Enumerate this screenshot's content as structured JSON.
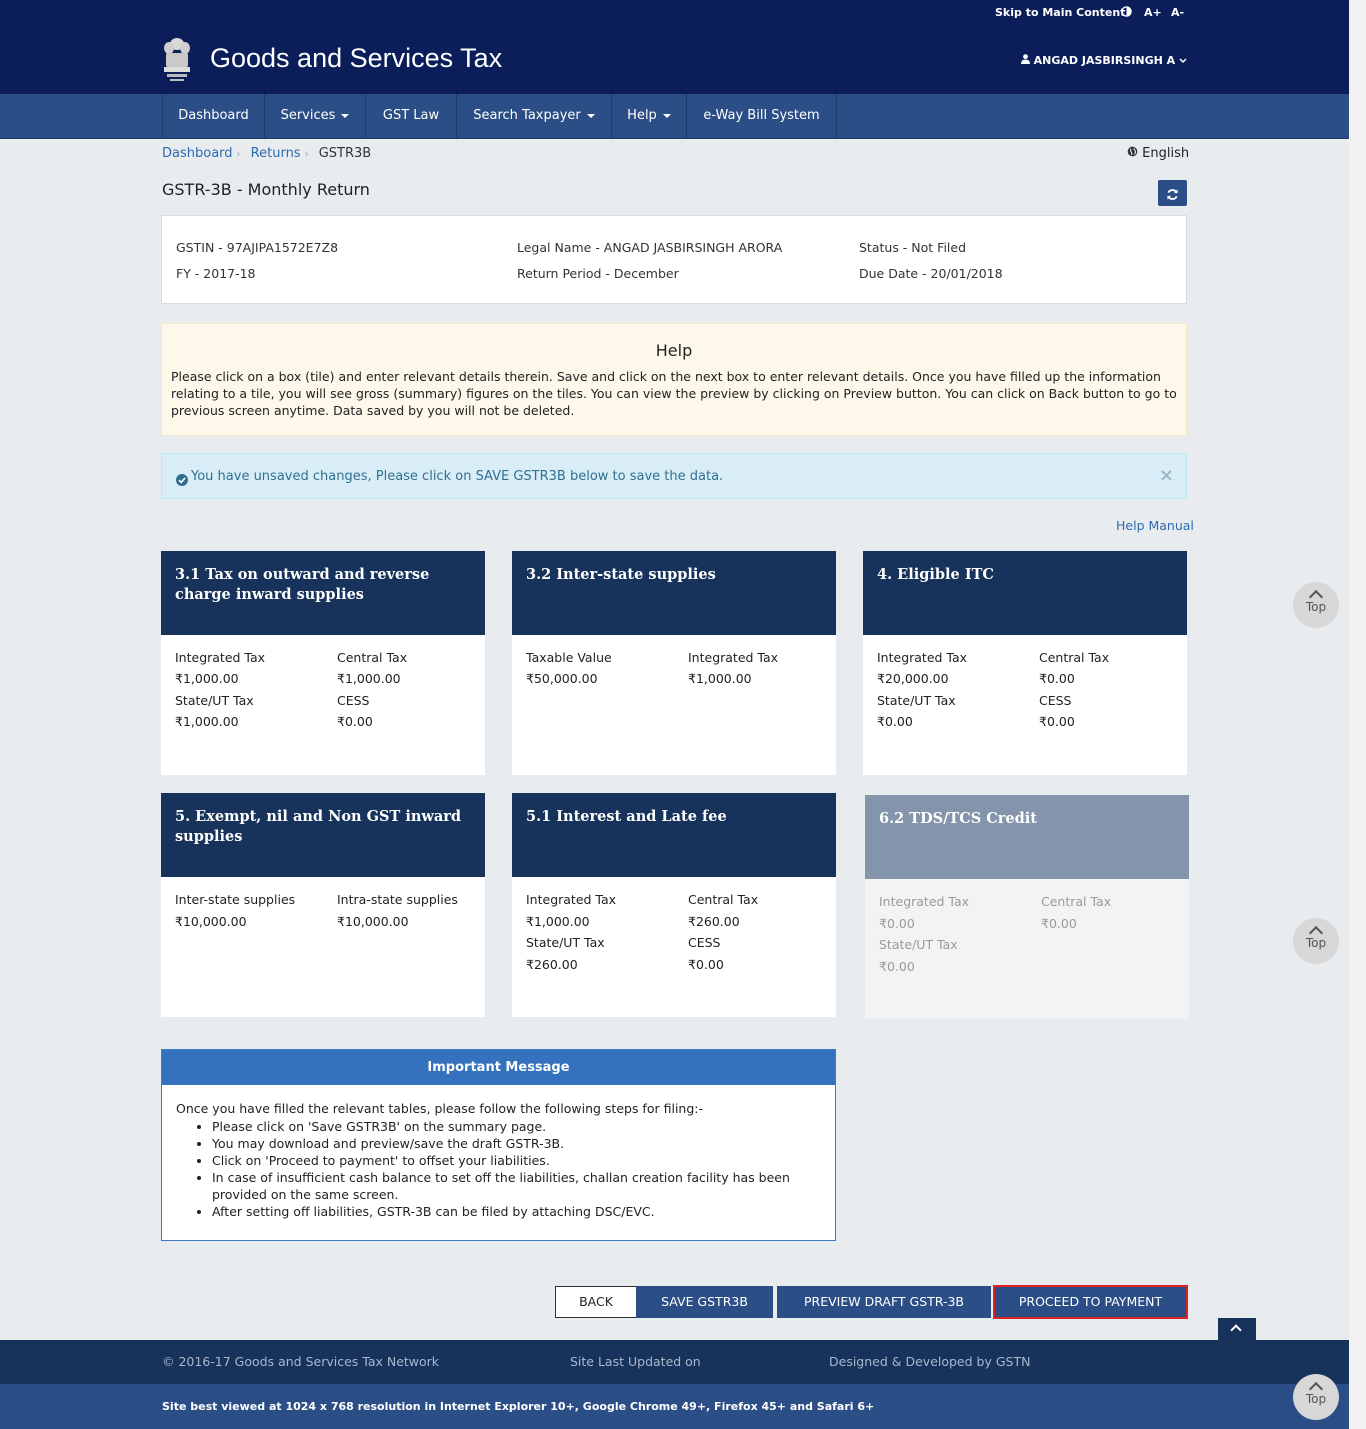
{
  "topbar": {
    "skip_link": "Skip to Main Content",
    "font_increase": "A+",
    "font_decrease": "A-"
  },
  "header": {
    "site_title": "Goods and Services Tax",
    "user_name": "ANGAD JASBIRSINGH A"
  },
  "nav": {
    "items": [
      {
        "label": "Dashboard"
      },
      {
        "label": "Services"
      },
      {
        "label": "GST Law"
      },
      {
        "label": "Search Taxpayer"
      },
      {
        "label": "Help"
      },
      {
        "label": "e-Way Bill System"
      }
    ]
  },
  "breadcrumb": {
    "items": [
      "Dashboard",
      "Returns"
    ],
    "current": "GSTR3B"
  },
  "language": "English",
  "page_title": "GSTR-3B - Monthly Return",
  "info": {
    "gstin": "GSTIN - 97AJIPA1572E7Z8",
    "fy": "FY - 2017-18",
    "legal_name": "Legal Name - ANGAD JASBIRSINGH ARORA",
    "return_period": "Return Period - December",
    "status": "Status - Not Filed",
    "due_date": "Due Date - 20/01/2018"
  },
  "help": {
    "title": "Help",
    "text": "Please click on a box (tile) and enter relevant details therein. Save and click on the next box to enter relevant details. Once you have filled up the information relating to a tile, you will see gross (summary) figures on the tiles. You can view the preview by clicking on Preview button. You can click on Back button to go to previous screen anytime. Data saved by you will not be deleted."
  },
  "alert": {
    "text": "You have unsaved changes, Please click on SAVE GSTR3B below to save the data.",
    "close": "×"
  },
  "help_manual": "Help Manual",
  "tiles": [
    {
      "title": "3.1 Tax on outward and reverse charge inward supplies",
      "l1": "Integrated Tax",
      "v1": "₹1,000.00",
      "l2": "Central Tax",
      "v2": "₹1,000.00",
      "l3": "State/UT Tax",
      "v3": "₹1,000.00",
      "l4": "CESS",
      "v4": "₹0.00"
    },
    {
      "title": "3.2 Inter-state supplies",
      "l1": "Taxable Value",
      "v1": "₹50,000.00",
      "l2": "Integrated Tax",
      "v2": "₹1,000.00"
    },
    {
      "title": "4. Eligible ITC",
      "l1": "Integrated Tax",
      "v1": "₹20,000.00",
      "l2": "Central Tax",
      "v2": "₹0.00",
      "l3": "State/UT Tax",
      "v3": "₹0.00",
      "l4": "CESS",
      "v4": "₹0.00"
    },
    {
      "title": "5. Exempt, nil and Non GST inward supplies",
      "l1": "Inter-state supplies",
      "v1": "₹10,000.00",
      "l2": "Intra-state supplies",
      "v2": "₹10,000.00"
    },
    {
      "title": "5.1 Interest and Late fee",
      "l1": "Integrated Tax",
      "v1": "₹1,000.00",
      "l2": "Central Tax",
      "v2": "₹260.00",
      "l3": "State/UT Tax",
      "v3": "₹260.00",
      "l4": "CESS",
      "v4": "₹0.00"
    },
    {
      "title": "6.2 TDS/TCS Credit",
      "l1": "Integrated Tax",
      "v1": "₹0.00",
      "l2": "Central Tax",
      "v2": "₹0.00",
      "l3": "State/UT Tax",
      "v3": "₹0.00"
    }
  ],
  "important": {
    "title": "Important Message",
    "intro": "Once you have filled the relevant tables, please follow the following steps for filing:-",
    "steps": [
      "Please click on 'Save GSTR3B' on the summary page.",
      "You may download and preview/save the draft GSTR-3B.",
      "Click on 'Proceed to payment' to offset your liabilities.",
      "In case of insufficient cash balance to set off the liabilities, challan creation facility has been provided on the same screen.",
      "After setting off liabilities, GSTR-3B can be filed by attaching DSC/EVC."
    ]
  },
  "buttons": {
    "back": "BACK",
    "save": "SAVE GSTR3B",
    "preview": "PREVIEW DRAFT GSTR-3B",
    "proceed": "PROCEED TO PAYMENT"
  },
  "scroll_top_label": "Top",
  "footer": {
    "copyright": "© 2016-17 Goods and Services Tax Network",
    "last_updated": "Site Last Updated on",
    "designed_by": "Designed & Developed by GSTN",
    "best_viewed": "Site best viewed at 1024 x 768 resolution in Internet Explorer 10+, Google Chrome 49+, Firefox 45+ and Safari 6+"
  },
  "colors": {
    "header_bg": "#0b1e59",
    "nav_bg": "#2c4e86",
    "tile_head": "#17335b",
    "tile_head_disabled": "#8494aa",
    "highlight_outline": "#e0221e"
  }
}
